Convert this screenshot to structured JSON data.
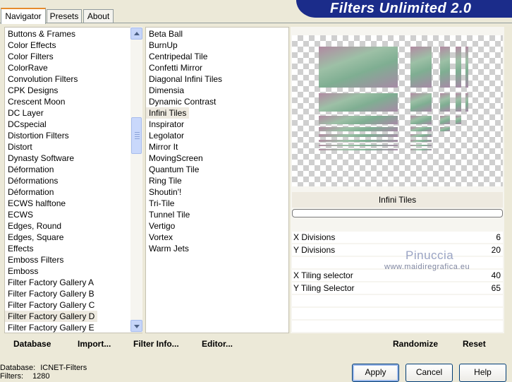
{
  "tabs": [
    "Navigator",
    "Presets",
    "About"
  ],
  "banner_title": "Filters Unlimited 2.0",
  "categories": [
    "Buttons & Frames",
    "Color Effects",
    "Color Filters",
    "ColorRave",
    "Convolution Filters",
    "CPK Designs",
    "Crescent Moon",
    "DC Layer",
    "DCspecial",
    "Distortion Filters",
    "Distort",
    "Dynasty Software",
    "Déformation",
    "Déformations",
    "Déformation",
    "ECWS halftone",
    "ECWS",
    "Edges, Round",
    "Edges, Square",
    "Effects",
    "Emboss Filters",
    "Emboss",
    "Filter Factory Gallery A",
    "Filter Factory Gallery B",
    "Filter Factory Gallery C",
    "Filter Factory Gallery D",
    "Filter Factory Gallery E"
  ],
  "selected_category": "Filter Factory Gallery D",
  "filters": [
    "Beta Ball",
    "BurnUp",
    "Centripedal Tile",
    "Confetti Mirror",
    "Diagonal Infini Tiles",
    "Dimensia",
    "Dynamic Contrast",
    "Infini Tiles",
    "Inspirator",
    "Legolator",
    "Mirror It",
    "MovingScreen",
    "Quantum Tile",
    "Ring Tile",
    "Shoutin'!",
    "Tri-Tile",
    "Tunnel Tile",
    "Vertigo",
    "Vortex",
    "Warm Jets"
  ],
  "selected_filter": "Infini Tiles",
  "params": [
    {
      "label": "X Divisions",
      "value": "6"
    },
    {
      "label": "Y Divisions",
      "value": "20"
    },
    {
      "label": "X Tiling selector",
      "value": "40"
    },
    {
      "label": "Y Tiling Selector",
      "value": "65"
    }
  ],
  "watermark": {
    "name": "Pinuccia",
    "url": "www.maidiregrafica.eu"
  },
  "toolbar": {
    "database": "Database",
    "import": "Import...",
    "filter_info": "Filter Info...",
    "editor": "Editor...",
    "randomize": "Randomize",
    "reset": "Reset"
  },
  "status": {
    "database_label": "Database:",
    "database_value": "ICNET-Filters",
    "filters_label": "Filters:",
    "filters_value": "1280"
  },
  "buttons": {
    "apply": "Apply",
    "cancel": "Cancel",
    "help": "Help"
  },
  "colors": {
    "banner": "#1b2c8a",
    "selection": "#eeeae0",
    "tab_accent": "#e68b2c"
  }
}
